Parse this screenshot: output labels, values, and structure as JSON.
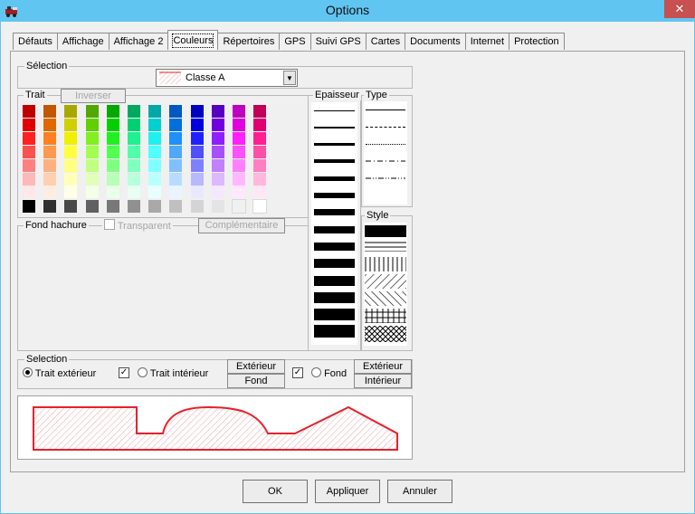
{
  "window": {
    "title": "Options",
    "close_glyph": "✕"
  },
  "tabs": [
    {
      "label": "Défauts",
      "active": false
    },
    {
      "label": "Affichage",
      "active": false
    },
    {
      "label": "Affichage 2",
      "active": false
    },
    {
      "label": "Couleurs",
      "active": true
    },
    {
      "label": "Répertoires",
      "active": false
    },
    {
      "label": "GPS",
      "active": false
    },
    {
      "label": "Suivi GPS",
      "active": false
    },
    {
      "label": "Cartes",
      "active": false
    },
    {
      "label": "Documents",
      "active": false
    },
    {
      "label": "Internet",
      "active": false
    },
    {
      "label": "Protection",
      "active": false
    }
  ],
  "selection_group": {
    "label": "Sélection",
    "combo_value": "Classe A"
  },
  "trait_group": {
    "label": "Trait",
    "inverser_label": "Inverser"
  },
  "palette": {
    "columns": [
      [
        "#c00000",
        "#e00000",
        "#ff2020",
        "#ff5050",
        "#ff8080",
        "#ffb8b8",
        "#ffe8e8",
        "#000000"
      ],
      [
        "#c05800",
        "#e06800",
        "#ff8020",
        "#ff9850",
        "#ffb080",
        "#ffd0b0",
        "#ffeee0",
        "#303030"
      ],
      [
        "#a8a800",
        "#d0d000",
        "#f0f000",
        "#ffff40",
        "#ffff80",
        "#ffffb8",
        "#ffffe8",
        "#484848"
      ],
      [
        "#50a800",
        "#60d000",
        "#80f020",
        "#a0ff50",
        "#c0ff80",
        "#e0ffb8",
        "#f4ffe8",
        "#606060"
      ],
      [
        "#00a800",
        "#00d000",
        "#20f020",
        "#50ff50",
        "#80ff80",
        "#b8ffb8",
        "#e8ffe8",
        "#787878"
      ],
      [
        "#00a860",
        "#00d070",
        "#20f090",
        "#50ffa8",
        "#80ffc0",
        "#b8ffdc",
        "#e8fff4",
        "#909090"
      ],
      [
        "#00a8a8",
        "#00d0d0",
        "#20f0f0",
        "#50ffff",
        "#80ffff",
        "#b8ffff",
        "#e8ffff",
        "#a8a8a8"
      ],
      [
        "#0058c0",
        "#0070e0",
        "#2090ff",
        "#50a8ff",
        "#80c0ff",
        "#b8dcff",
        "#e8f4ff",
        "#c0c0c0"
      ],
      [
        "#0000c0",
        "#0000e0",
        "#2020ff",
        "#5050ff",
        "#8080ff",
        "#b8b8ff",
        "#e8e8ff",
        "#d4d4d4"
      ],
      [
        "#5800c0",
        "#7000e0",
        "#9020ff",
        "#a850ff",
        "#c080ff",
        "#dcb8ff",
        "#f4e8ff",
        "#e4e4e4"
      ],
      [
        "#c000c0",
        "#e000e0",
        "#ff20ff",
        "#ff50ff",
        "#ff80ff",
        "#ffb8ff",
        "#ffe8ff",
        "#f0f0f0"
      ],
      [
        "#c00058",
        "#e00070",
        "#ff2090",
        "#ff50a8",
        "#ff80c0",
        "#ffb8dc",
        "#ffe8f4",
        "#ffffff"
      ]
    ]
  },
  "epaisseur_group": {
    "label": "Epaisseur",
    "thicknesses": [
      1,
      2,
      3,
      4,
      5,
      6,
      7,
      8,
      9,
      10,
      11,
      12,
      13,
      14
    ]
  },
  "type_group": {
    "label": "Type",
    "dashes": [
      "solid",
      "long-dash",
      "dotted",
      "dash-dot",
      "dash-dot-dot"
    ]
  },
  "style_group": {
    "label": "Style",
    "patterns": [
      "solid",
      "horizontal",
      "vertical",
      "diagonal-right",
      "diagonal-left",
      "cross",
      "diagonal-cross"
    ]
  },
  "fond_group": {
    "label": "Fond hachure",
    "transparent_label": "Transparent",
    "transparent_checked": false,
    "complementaire_label": "Complémentaire"
  },
  "selection2_group": {
    "label": "Selection",
    "trait_exterieur_label": "Trait extérieur",
    "trait_exterieur_selected": true,
    "trait_exterieur_check": true,
    "trait_interieur_label": "Trait intérieur",
    "trait_interieur_selected": false,
    "btn_exterieur": "Extérieur",
    "btn_fond": "Fond",
    "fond_check": true,
    "fond_label": "Fond",
    "fond_selected": false,
    "btn_exterieur2": "Extérieur",
    "btn_interieur": "Intérieur"
  },
  "colors": {
    "preview_stroke": "#e8202a",
    "preview_hatch": "#f3a0a0",
    "titlebar": "#61c5f2",
    "close_bg": "#c75050"
  },
  "buttons": {
    "ok": "OK",
    "appliquer": "Appliquer",
    "annuler": "Annuler"
  }
}
